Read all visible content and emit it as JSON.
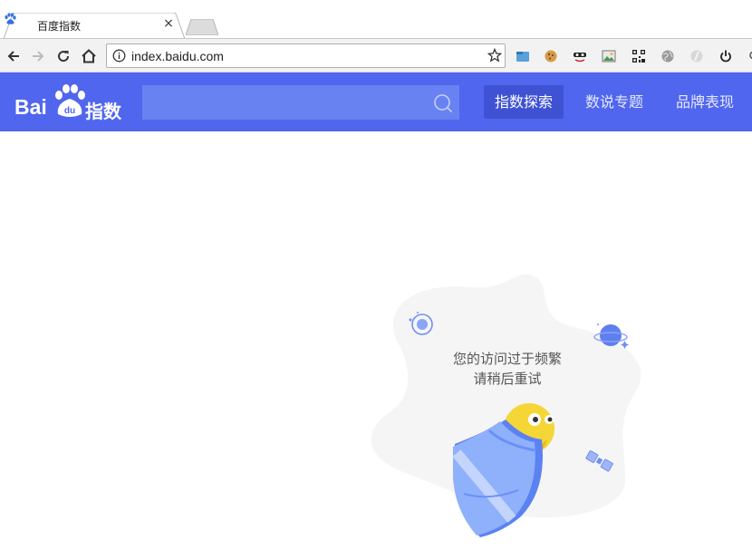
{
  "browser": {
    "tab": {
      "title": "百度指数",
      "close_label": "×"
    },
    "omnibox": {
      "url": "index.baidu.com"
    }
  },
  "header": {
    "logo": {
      "bai": "Bai",
      "du": "du",
      "zhishu": "指数"
    },
    "search": {
      "placeholder": ""
    },
    "nav": [
      {
        "label": "指数探索",
        "active": true
      },
      {
        "label": "数说专题",
        "active": false
      },
      {
        "label": "品牌表现",
        "active": false
      }
    ]
  },
  "error": {
    "line1": "您的访问过于频繁",
    "line2": "请稍后重试"
  },
  "colors": {
    "header_bg": "#5066ee",
    "nav_active_bg": "#3f52d3",
    "search_bg": "#6982f2"
  }
}
